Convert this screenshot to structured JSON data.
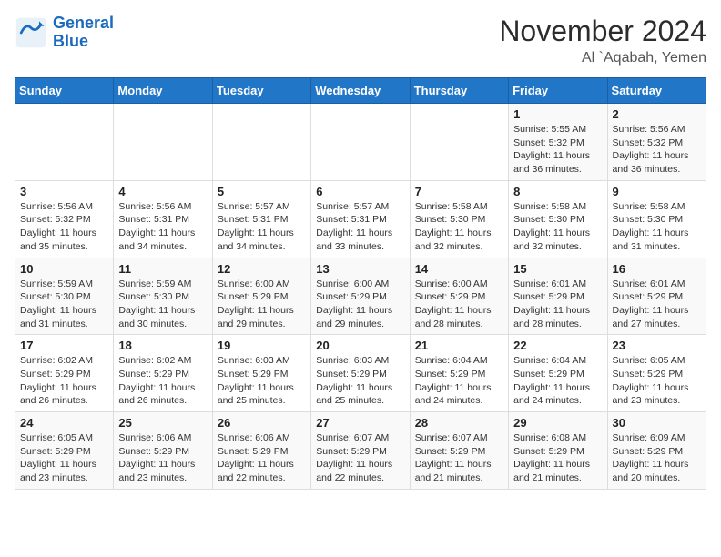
{
  "logo": {
    "line1": "General",
    "line2": "Blue"
  },
  "header": {
    "month": "November 2024",
    "location": "Al `Aqabah, Yemen"
  },
  "days_of_week": [
    "Sunday",
    "Monday",
    "Tuesday",
    "Wednesday",
    "Thursday",
    "Friday",
    "Saturday"
  ],
  "weeks": [
    [
      {
        "day": "",
        "info": ""
      },
      {
        "day": "",
        "info": ""
      },
      {
        "day": "",
        "info": ""
      },
      {
        "day": "",
        "info": ""
      },
      {
        "day": "",
        "info": ""
      },
      {
        "day": "1",
        "info": "Sunrise: 5:55 AM\nSunset: 5:32 PM\nDaylight: 11 hours and 36 minutes."
      },
      {
        "day": "2",
        "info": "Sunrise: 5:56 AM\nSunset: 5:32 PM\nDaylight: 11 hours and 36 minutes."
      }
    ],
    [
      {
        "day": "3",
        "info": "Sunrise: 5:56 AM\nSunset: 5:32 PM\nDaylight: 11 hours and 35 minutes."
      },
      {
        "day": "4",
        "info": "Sunrise: 5:56 AM\nSunset: 5:31 PM\nDaylight: 11 hours and 34 minutes."
      },
      {
        "day": "5",
        "info": "Sunrise: 5:57 AM\nSunset: 5:31 PM\nDaylight: 11 hours and 34 minutes."
      },
      {
        "day": "6",
        "info": "Sunrise: 5:57 AM\nSunset: 5:31 PM\nDaylight: 11 hours and 33 minutes."
      },
      {
        "day": "7",
        "info": "Sunrise: 5:58 AM\nSunset: 5:30 PM\nDaylight: 11 hours and 32 minutes."
      },
      {
        "day": "8",
        "info": "Sunrise: 5:58 AM\nSunset: 5:30 PM\nDaylight: 11 hours and 32 minutes."
      },
      {
        "day": "9",
        "info": "Sunrise: 5:58 AM\nSunset: 5:30 PM\nDaylight: 11 hours and 31 minutes."
      }
    ],
    [
      {
        "day": "10",
        "info": "Sunrise: 5:59 AM\nSunset: 5:30 PM\nDaylight: 11 hours and 31 minutes."
      },
      {
        "day": "11",
        "info": "Sunrise: 5:59 AM\nSunset: 5:30 PM\nDaylight: 11 hours and 30 minutes."
      },
      {
        "day": "12",
        "info": "Sunrise: 6:00 AM\nSunset: 5:29 PM\nDaylight: 11 hours and 29 minutes."
      },
      {
        "day": "13",
        "info": "Sunrise: 6:00 AM\nSunset: 5:29 PM\nDaylight: 11 hours and 29 minutes."
      },
      {
        "day": "14",
        "info": "Sunrise: 6:00 AM\nSunset: 5:29 PM\nDaylight: 11 hours and 28 minutes."
      },
      {
        "day": "15",
        "info": "Sunrise: 6:01 AM\nSunset: 5:29 PM\nDaylight: 11 hours and 28 minutes."
      },
      {
        "day": "16",
        "info": "Sunrise: 6:01 AM\nSunset: 5:29 PM\nDaylight: 11 hours and 27 minutes."
      }
    ],
    [
      {
        "day": "17",
        "info": "Sunrise: 6:02 AM\nSunset: 5:29 PM\nDaylight: 11 hours and 26 minutes."
      },
      {
        "day": "18",
        "info": "Sunrise: 6:02 AM\nSunset: 5:29 PM\nDaylight: 11 hours and 26 minutes."
      },
      {
        "day": "19",
        "info": "Sunrise: 6:03 AM\nSunset: 5:29 PM\nDaylight: 11 hours and 25 minutes."
      },
      {
        "day": "20",
        "info": "Sunrise: 6:03 AM\nSunset: 5:29 PM\nDaylight: 11 hours and 25 minutes."
      },
      {
        "day": "21",
        "info": "Sunrise: 6:04 AM\nSunset: 5:29 PM\nDaylight: 11 hours and 24 minutes."
      },
      {
        "day": "22",
        "info": "Sunrise: 6:04 AM\nSunset: 5:29 PM\nDaylight: 11 hours and 24 minutes."
      },
      {
        "day": "23",
        "info": "Sunrise: 6:05 AM\nSunset: 5:29 PM\nDaylight: 11 hours and 23 minutes."
      }
    ],
    [
      {
        "day": "24",
        "info": "Sunrise: 6:05 AM\nSunset: 5:29 PM\nDaylight: 11 hours and 23 minutes."
      },
      {
        "day": "25",
        "info": "Sunrise: 6:06 AM\nSunset: 5:29 PM\nDaylight: 11 hours and 23 minutes."
      },
      {
        "day": "26",
        "info": "Sunrise: 6:06 AM\nSunset: 5:29 PM\nDaylight: 11 hours and 22 minutes."
      },
      {
        "day": "27",
        "info": "Sunrise: 6:07 AM\nSunset: 5:29 PM\nDaylight: 11 hours and 22 minutes."
      },
      {
        "day": "28",
        "info": "Sunrise: 6:07 AM\nSunset: 5:29 PM\nDaylight: 11 hours and 21 minutes."
      },
      {
        "day": "29",
        "info": "Sunrise: 6:08 AM\nSunset: 5:29 PM\nDaylight: 11 hours and 21 minutes."
      },
      {
        "day": "30",
        "info": "Sunrise: 6:09 AM\nSunset: 5:29 PM\nDaylight: 11 hours and 20 minutes."
      }
    ]
  ]
}
